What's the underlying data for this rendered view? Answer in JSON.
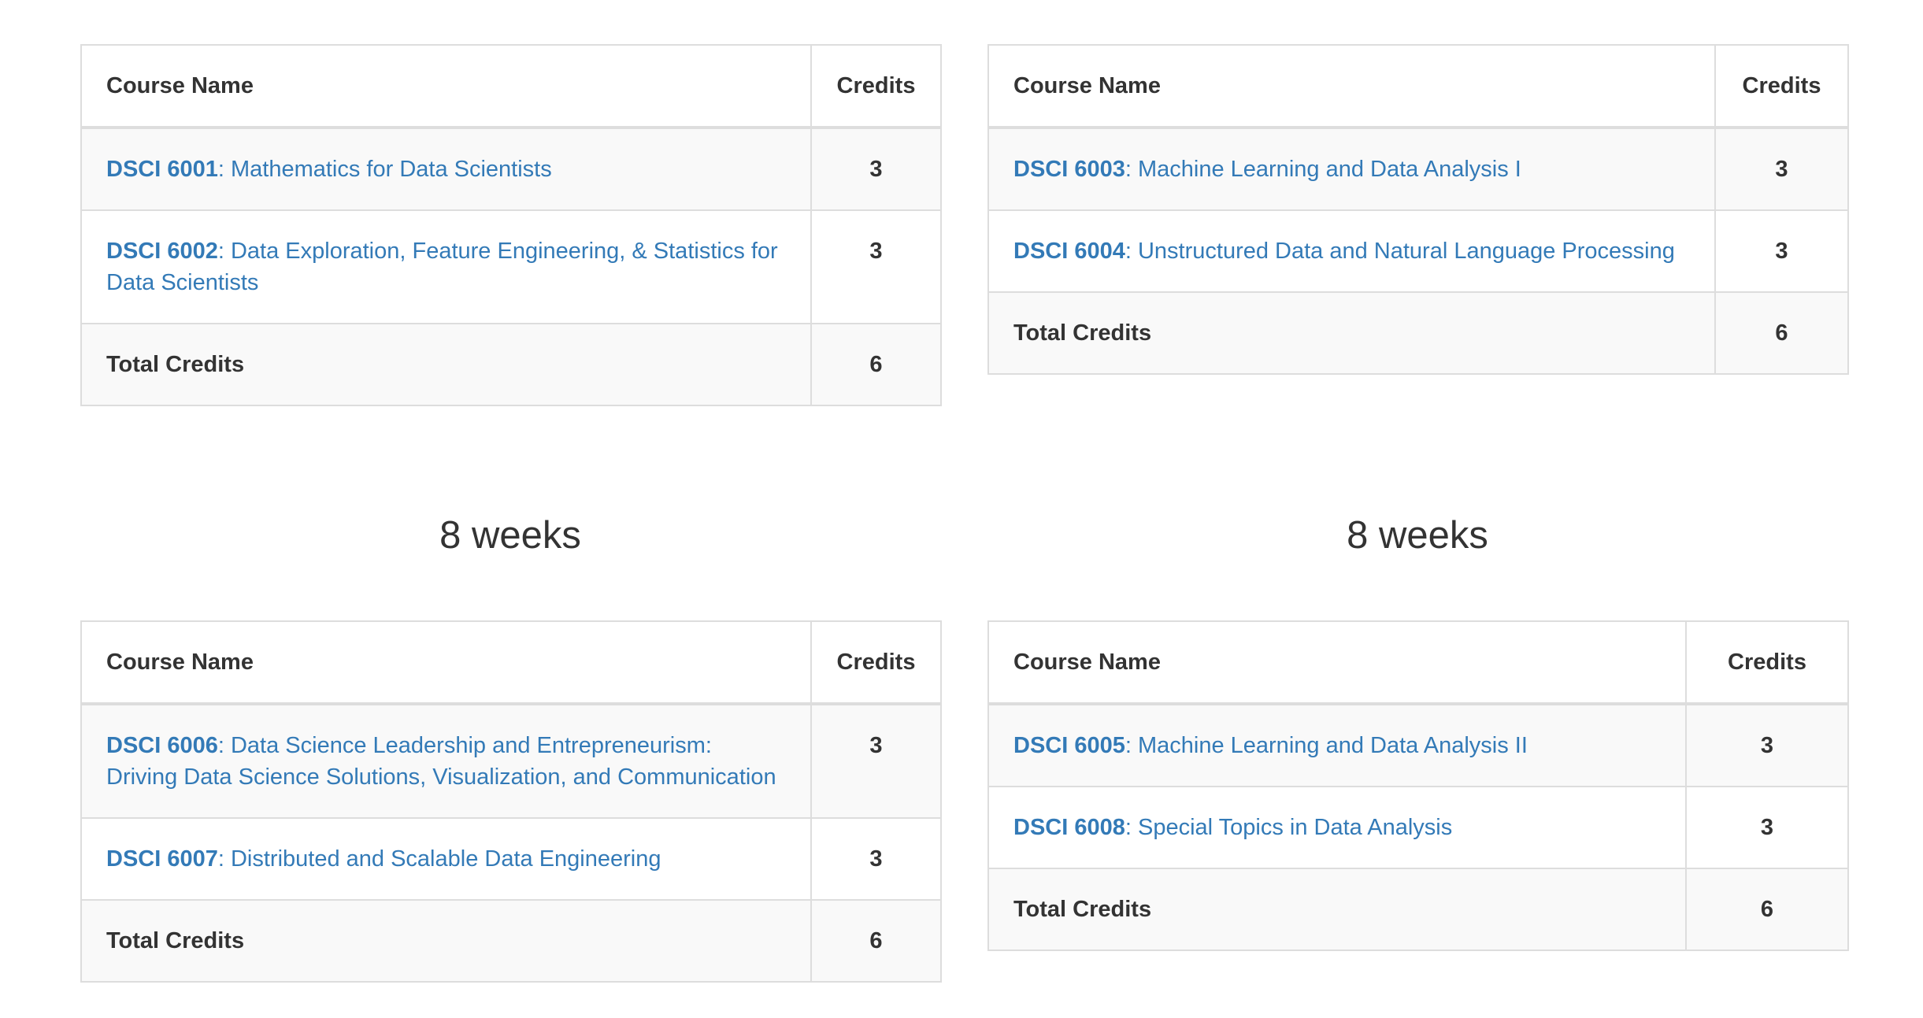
{
  "headers": {
    "course_name": "Course Name",
    "credits": "Credits"
  },
  "total_label": "Total Credits",
  "headings": {
    "bottom_left": "8 weeks",
    "bottom_right": "8 weeks"
  },
  "tables": {
    "top_left": {
      "rows": [
        {
          "code": "DSCI 6001",
          "title": ": Mathematics for Data Scientists",
          "credits": "3"
        },
        {
          "code": "DSCI 6002",
          "title": ": Data Exploration, Feature Engineering, & Statistics for Data Scientists",
          "credits": "3"
        }
      ],
      "total": "6"
    },
    "top_right": {
      "rows": [
        {
          "code": "DSCI 6003",
          "title": ": Machine Learning and Data Analysis I",
          "credits": "3"
        },
        {
          "code": "DSCI 6004",
          "title": ": Unstructured Data and Natural Language Processing",
          "credits": "3"
        }
      ],
      "total": "6"
    },
    "bottom_left": {
      "rows": [
        {
          "code": "DSCI 6006",
          "title": ": Data Science Leadership and Entrepreneurism: Driving Data Science Solutions, Visualization, and Communication",
          "credits": "3"
        },
        {
          "code": "DSCI 6007",
          "title": ": Distributed and Scalable Data Engineering",
          "credits": "3"
        }
      ],
      "total": "6"
    },
    "bottom_right": {
      "rows": [
        {
          "code": "DSCI 6005",
          "title": ": Machine Learning and Data Analysis II",
          "credits": "3"
        },
        {
          "code": "DSCI 6008",
          "title": ": Special Topics in Data Analysis",
          "credits": "3"
        }
      ],
      "total": "6"
    }
  },
  "colors": {
    "link": "#337ab7",
    "text": "#333333",
    "border": "#dddddd",
    "stripe": "#f9f9f9"
  }
}
